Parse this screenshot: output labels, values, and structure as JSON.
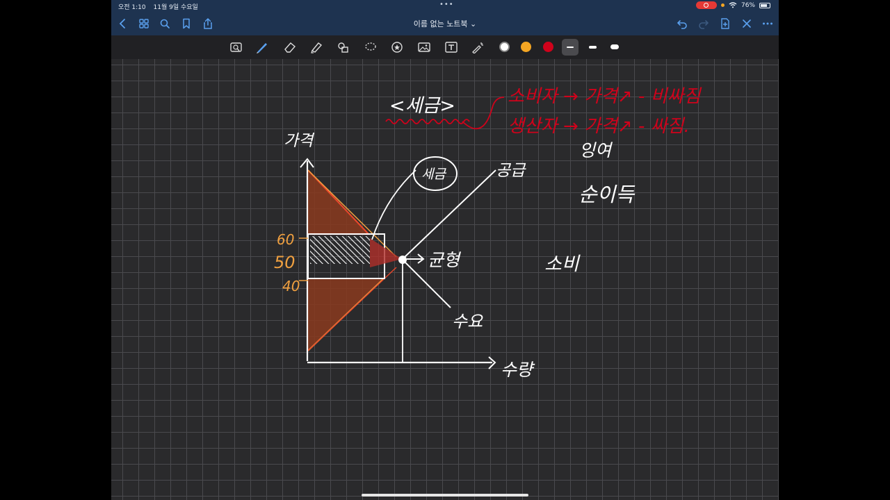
{
  "status_bar": {
    "time": "오전 1:10",
    "date": "11월 9일 수요일",
    "battery": "76%",
    "battery_fraction": 0.76
  },
  "nav": {
    "title": "이름 없는 노트북 ⌄",
    "icons": [
      "back-icon",
      "grid-icon",
      "search-icon",
      "bookmark-icon",
      "share-icon",
      "undo-icon",
      "redo-icon",
      "add-page-icon",
      "close-icon",
      "more-icon"
    ]
  },
  "toolbar": {
    "tools": [
      "zoom-window-icon",
      "pen-icon",
      "eraser-icon",
      "highlighter-icon",
      "shapes-icon",
      "lasso-icon",
      "sticker-icon",
      "image-icon",
      "text-icon",
      "laser-icon"
    ],
    "colors": [
      "#ffffff",
      "#f5a623",
      "#d0021b"
    ]
  },
  "note": {
    "title": "<세금>",
    "red_line1": "소비자 → 가격↗ - 비싸짐",
    "red_line2": "생산자 → 가격↗ - 싸짐.",
    "y_axis_label": "가격",
    "x_axis_label": "수량",
    "supply_label": "공급",
    "demand_label": "수요",
    "equilibrium_label": "균형",
    "tax_bubble": "세금",
    "surplus_label": "잉여",
    "deadweight_label": "순이득",
    "consumer_label": "소비",
    "price_high": "60",
    "price_mid": "50",
    "price_low": "40"
  }
}
